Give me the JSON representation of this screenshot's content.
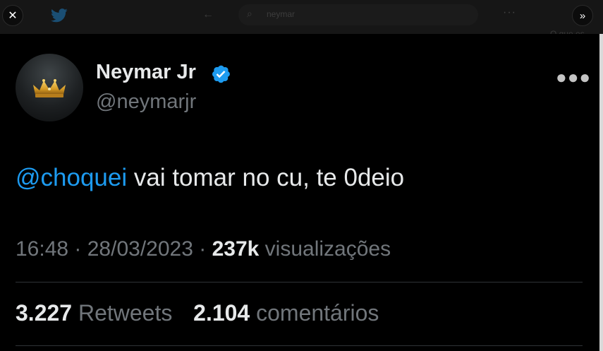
{
  "browser": {
    "search_query": "neymar",
    "corner_text": "O que es",
    "close_label": "✕",
    "expand_label": "»"
  },
  "tweet": {
    "display_name": "Neymar Jr",
    "handle": "@neymarjr",
    "mention": "@choquei",
    "text": " vai tomar no cu, te 0deio",
    "time": "16:48",
    "date": "28/03/2023",
    "views_count": "237k",
    "views_label": "visualizações",
    "retweets_count": "3.227",
    "retweets_label": "Retweets",
    "comments_count": "2.104",
    "comments_label": "comentários"
  },
  "colors": {
    "background": "#000000",
    "text_primary": "#e7e9ea",
    "text_secondary": "#71767b",
    "mention": "#1d9bf0",
    "verified_badge": "#1d9bf0"
  },
  "icons": [
    "close-icon",
    "twitter-bird-icon",
    "back-arrow-icon",
    "search-icon",
    "more-icon",
    "expand-icon",
    "verified-badge-icon",
    "crown-icon"
  ]
}
